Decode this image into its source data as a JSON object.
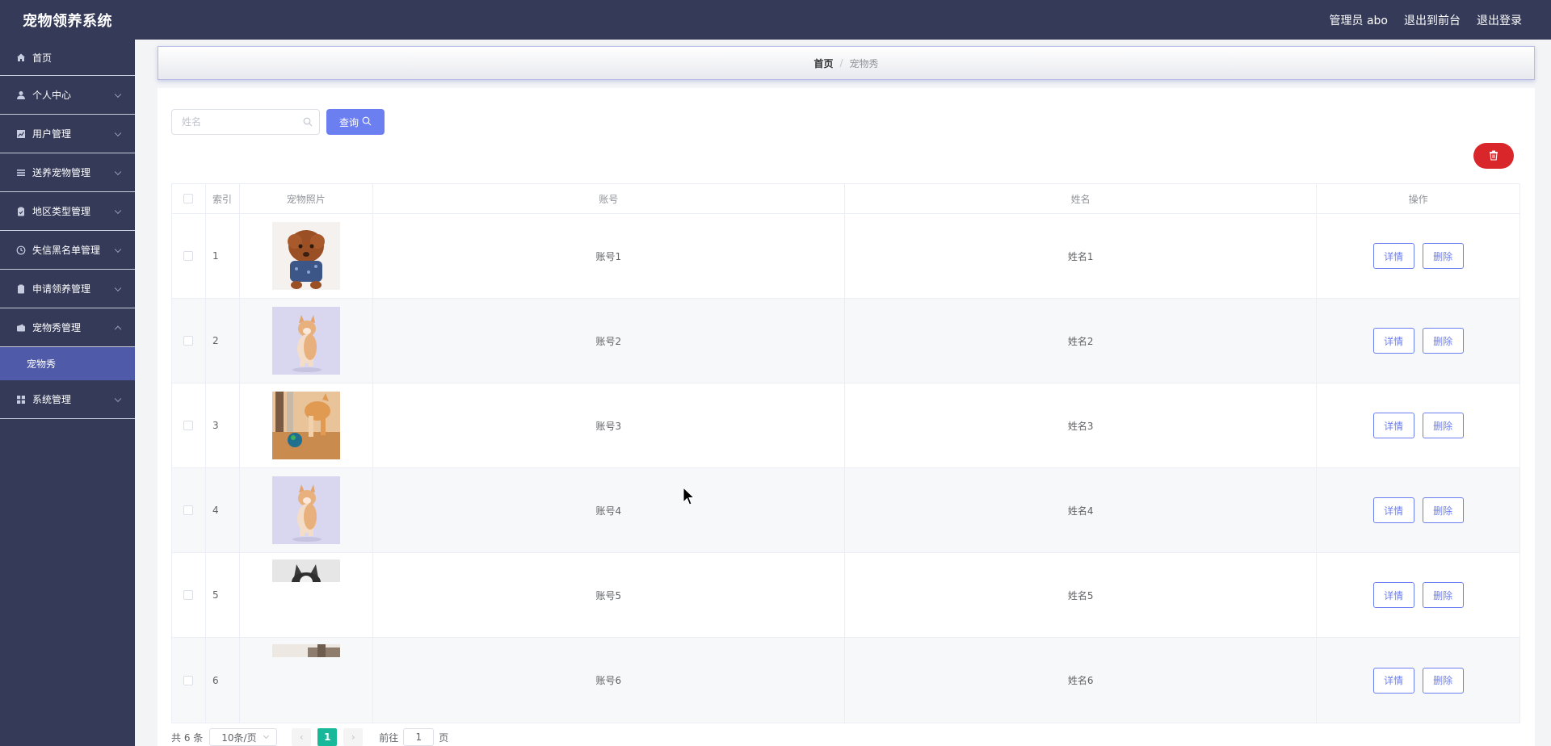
{
  "header": {
    "title": "宠物领养系统",
    "links": [
      "管理员 abo",
      "退出到前台",
      "退出登录"
    ]
  },
  "sidebar": {
    "items": [
      {
        "label": "首页",
        "icon": "home-icon"
      },
      {
        "label": "个人中心",
        "icon": "user-icon"
      },
      {
        "label": "用户管理",
        "icon": "chart-icon"
      },
      {
        "label": "送养宠物管理",
        "icon": "list-icon"
      },
      {
        "label": "地区类型管理",
        "icon": "clipboard-icon"
      },
      {
        "label": "失信黑名单管理",
        "icon": "clock-icon"
      },
      {
        "label": "申请领养管理",
        "icon": "clipboard-icon"
      },
      {
        "label": "宠物秀管理",
        "icon": "wallet-icon"
      },
      {
        "label": "系统管理",
        "icon": "grid-icon"
      }
    ],
    "active_sub": "宠物秀"
  },
  "breadcrumb": {
    "home": "首页",
    "separator": "/",
    "current": "宠物秀"
  },
  "search": {
    "placeholder": "姓名",
    "button_label": "查询"
  },
  "table": {
    "columns": [
      "索引",
      "宠物照片",
      "账号",
      "姓名",
      "操作"
    ],
    "rows": [
      {
        "index": "1",
        "account": "账号1",
        "name": "姓名1",
        "photo": "poodle-photo"
      },
      {
        "index": "2",
        "account": "账号2",
        "name": "姓名2",
        "photo": "cat-photo"
      },
      {
        "index": "3",
        "account": "账号3",
        "name": "姓名3",
        "photo": "cat-ball-photo"
      },
      {
        "index": "4",
        "account": "账号4",
        "name": "姓名4",
        "photo": "cat-photo"
      },
      {
        "index": "5",
        "account": "账号5",
        "name": "姓名5",
        "photo": "husky-photo"
      },
      {
        "index": "6",
        "account": "账号6",
        "name": "姓名6",
        "photo": "partial-photo"
      }
    ],
    "detail_label": "详情",
    "delete_label": "删除"
  },
  "pagination": {
    "total": "共 6 条",
    "page_size": "10条/页",
    "current_page": "1",
    "goto_prefix": "前往",
    "goto_value": "1",
    "goto_suffix": "页"
  },
  "colors": {
    "header_bg": "#343a58",
    "accent": "#6c7ff0",
    "danger": "#d9262b",
    "active_sub_bg": "#4f5ba8",
    "pager_active": "#18b99b"
  }
}
